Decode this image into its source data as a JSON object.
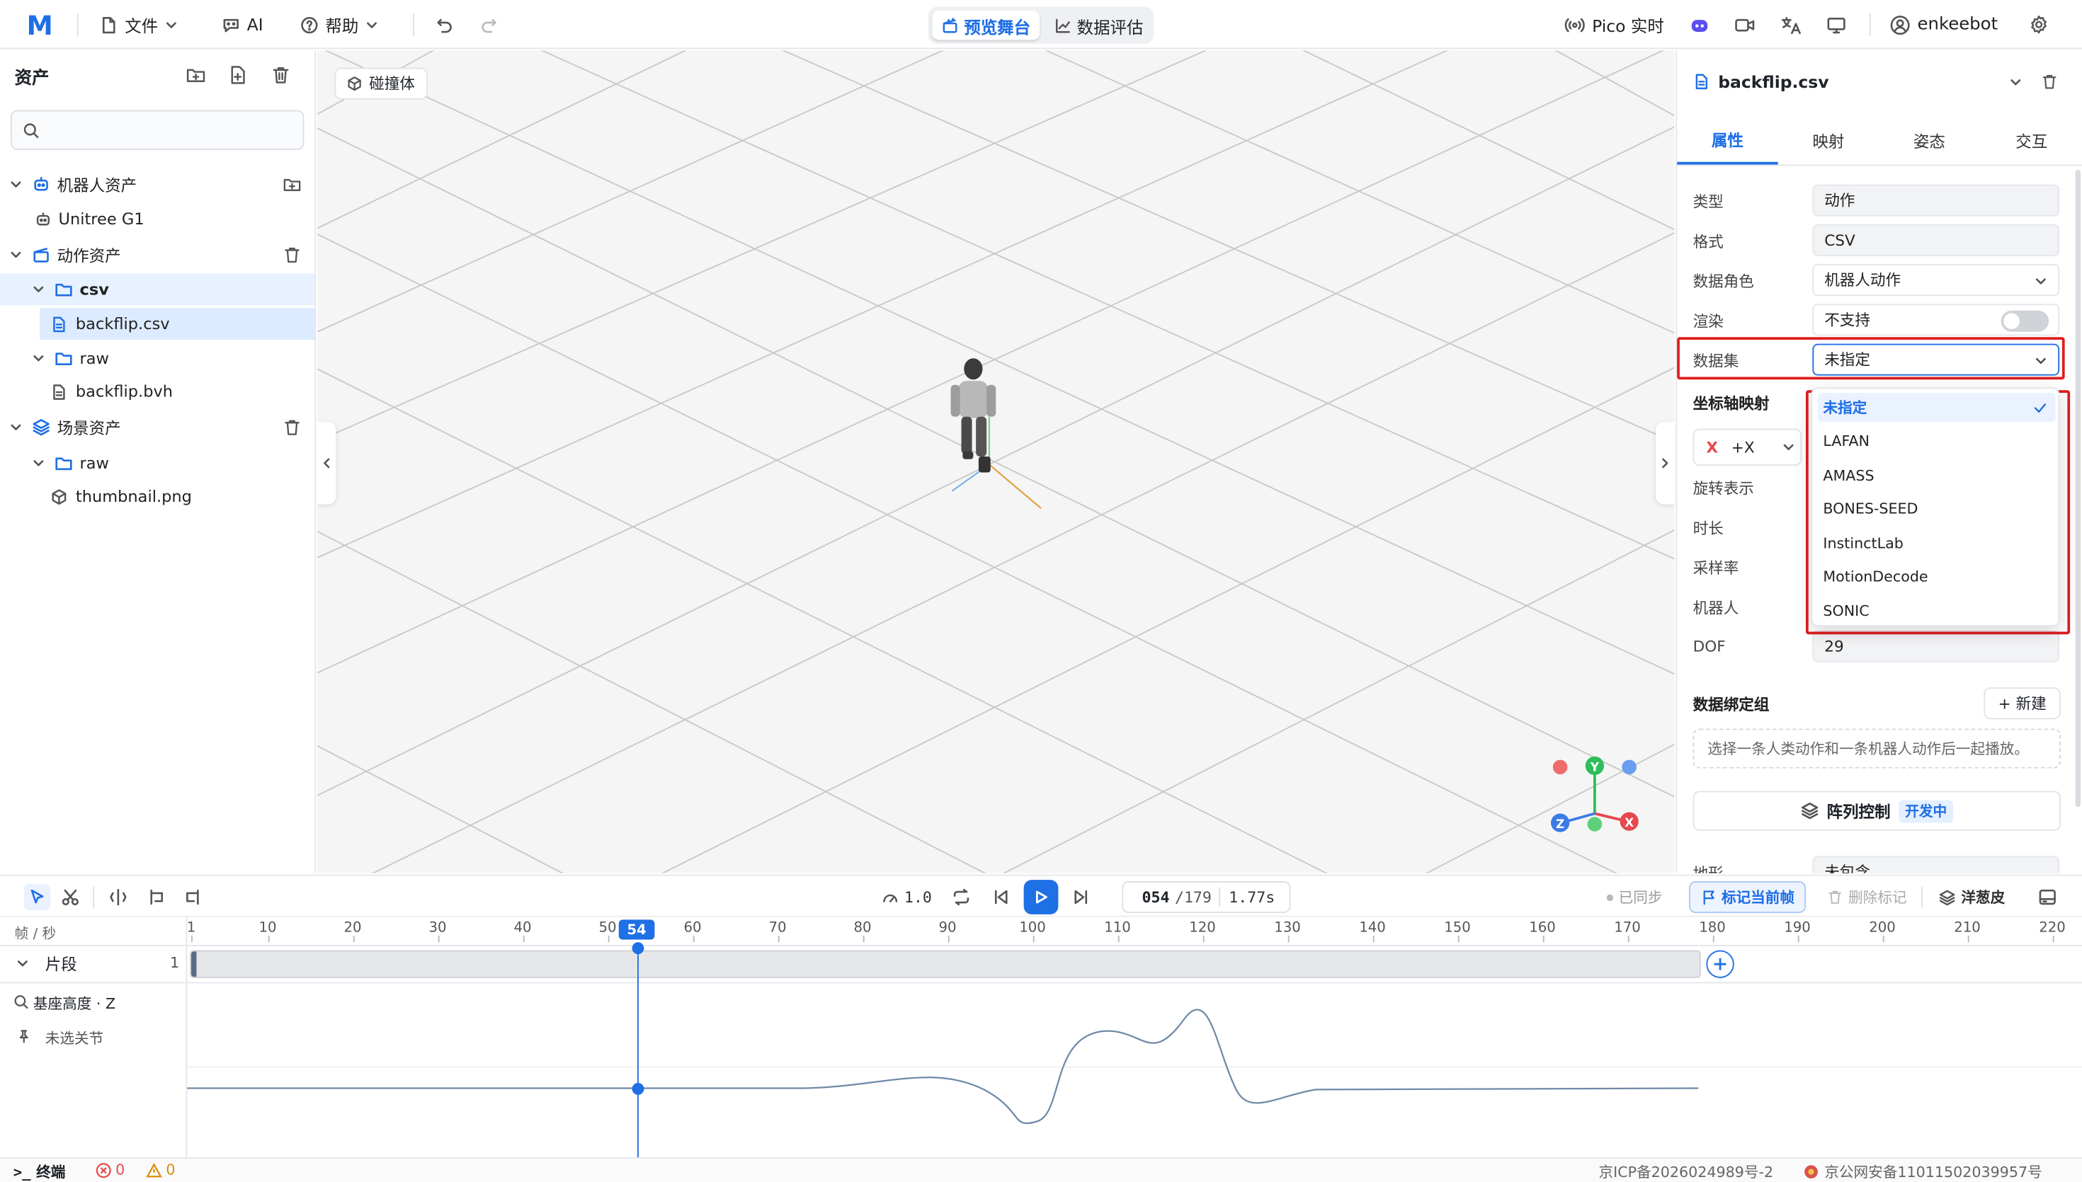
{
  "colors": {
    "accent": "#1f6fe5",
    "red": "#e01e1e",
    "toggle_off": "#d0d3d8"
  },
  "topbar": {
    "logo": "M",
    "file": "文件",
    "ai": "AI",
    "help": "帮助",
    "seg_preview": "预览舞台",
    "seg_eval": "数据评估",
    "pico": "Pico 实时",
    "user": "enkeebot"
  },
  "assets": {
    "title": "资产",
    "search_placeholder": "",
    "robot_group": "机器人资产",
    "robot_item": "Unitree G1",
    "motion_group": "动作资产",
    "folder_csv": "csv",
    "file_csv": "backflip.csv",
    "folder_raw": "raw",
    "file_bvh": "backflip.bvh",
    "scene_group": "场景资产",
    "scene_raw": "raw",
    "scene_file": "thumbnail.png"
  },
  "viewport": {
    "collider_button": "碰撞体",
    "axis_y": "Y",
    "axis_z": "Z",
    "axis_x": "X"
  },
  "props": {
    "filename": "backflip.csv",
    "tabs": [
      "属性",
      "映射",
      "姿态",
      "交互"
    ],
    "type_label": "类型",
    "type_value": "动作",
    "format_label": "格式",
    "format_value": "CSV",
    "role_label": "数据角色",
    "role_value": "机器人动作",
    "render_label": "渲染",
    "render_value": "不支持",
    "dataset_label": "数据集",
    "dataset_value": "未指定",
    "axis_label": "坐标轴映射",
    "axis_x_label": "X",
    "axis_x_value": "+X",
    "rotation_label": "旋转表示",
    "duration_label": "时长",
    "samplerate_label": "采样率",
    "robot_label": "机器人",
    "dof_label": "DOF",
    "dof_value": "29",
    "binding_label": "数据绑定组",
    "new_button": "+ 新建",
    "binding_hint": "选择一条人类动作和一条机器人动作后一起播放。",
    "array_button": "阵列控制",
    "array_badge": "开发中",
    "terrain_label": "地形",
    "terrain_value": "未包含"
  },
  "dataset_options": [
    "未指定",
    "LAFAN",
    "AMASS",
    "BONES-SEED",
    "InstinctLab",
    "MotionDecode",
    "SONIC"
  ],
  "timeline": {
    "speed": "1.0",
    "frame_current": "054",
    "frame_total": "/179",
    "time": "1.77s",
    "synced": "已同步",
    "mark_current": "标记当前帧",
    "delete_mark": "删除标记",
    "onion": "洋葱皮",
    "unit_label": "帧 / 秒",
    "playhead": "54",
    "ticks": [
      "1",
      "10",
      "20",
      "30",
      "40",
      "50",
      "60",
      "70",
      "80",
      "90",
      "100",
      "110",
      "120",
      "130",
      "140",
      "150",
      "160",
      "170",
      "180",
      "190",
      "200",
      "210",
      "220"
    ],
    "track_label": "片段",
    "track_count": "1",
    "curve_label": "基座高度 · Z",
    "joint_label": "未选关节"
  },
  "status": {
    "terminal": "终端",
    "errors": "0",
    "warnings": "0",
    "icp": "京ICP备2026024989号-2",
    "police": "京公网安备11011502039957号"
  }
}
